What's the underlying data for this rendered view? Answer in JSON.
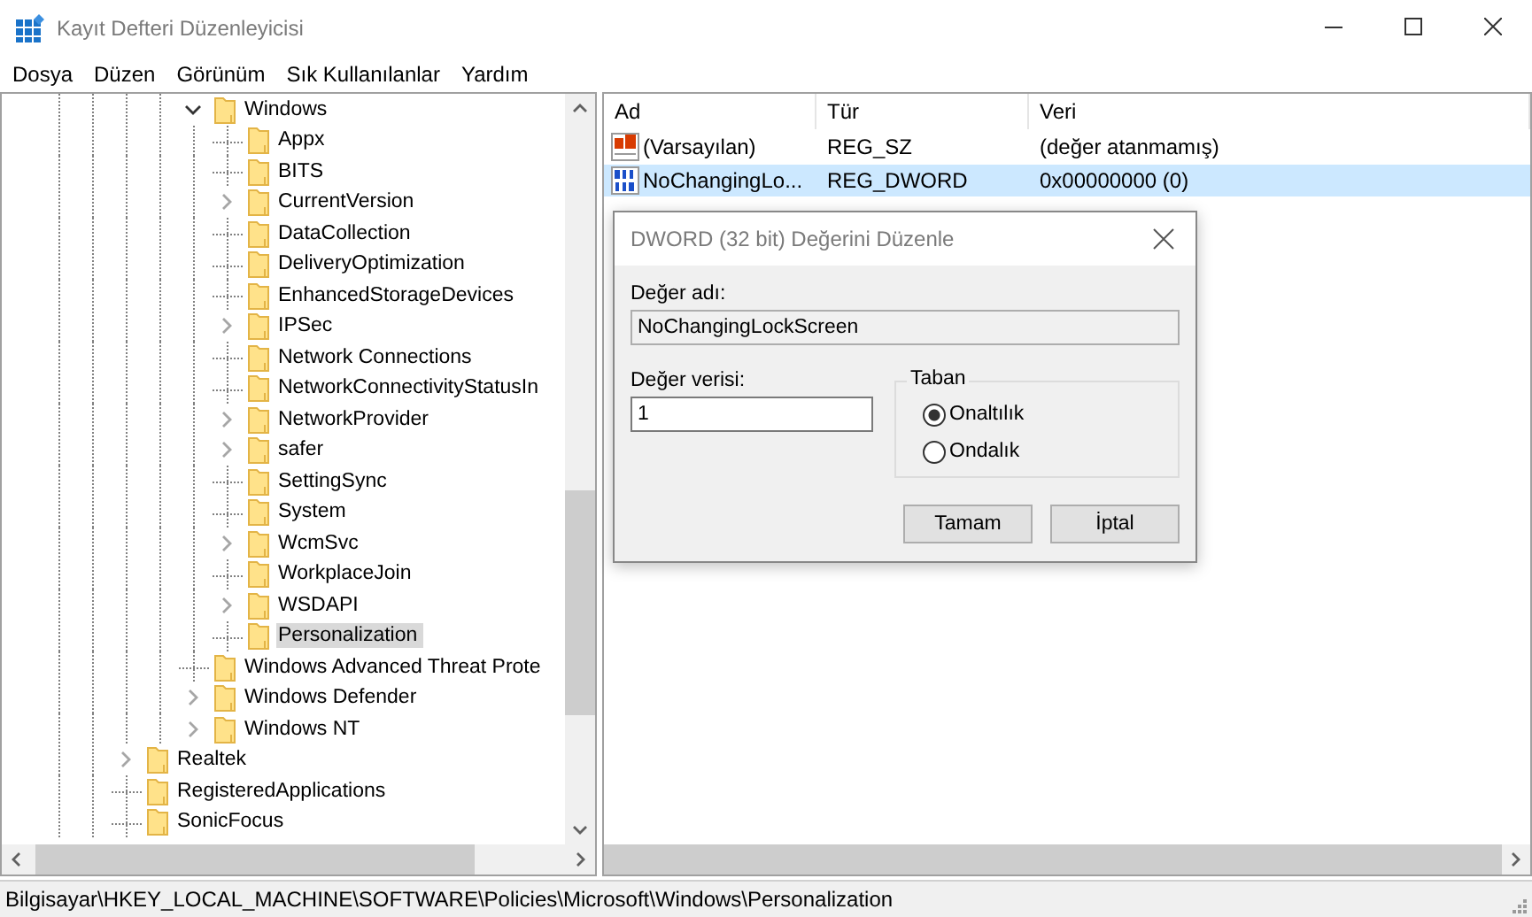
{
  "window": {
    "title": "Kayıt Defteri Düzenleyicisi"
  },
  "menu": [
    "Dosya",
    "Düzen",
    "Görünüm",
    "Sık Kullanılanlar",
    "Yardım"
  ],
  "tree": {
    "items": [
      {
        "children": [
          {
            "children": [
              {
                "label": "Windows",
                "expandable": true,
                "expanded": true,
                "selected": false,
                "children": [
                  {
                    "label": "Appx",
                    "expandable": false,
                    "expanded": false,
                    "selected": false
                  },
                  {
                    "label": "BITS",
                    "expandable": false,
                    "expanded": false,
                    "selected": false
                  },
                  {
                    "label": "CurrentVersion",
                    "expandable": true,
                    "expanded": false,
                    "selected": false
                  },
                  {
                    "label": "DataCollection",
                    "expandable": false,
                    "expanded": false,
                    "selected": false
                  },
                  {
                    "label": "DeliveryOptimization",
                    "expandable": false,
                    "expanded": false,
                    "selected": false
                  },
                  {
                    "label": "EnhancedStorageDevices",
                    "expandable": false,
                    "expanded": false,
                    "selected": false
                  },
                  {
                    "label": "IPSec",
                    "expandable": true,
                    "expanded": false,
                    "selected": false
                  },
                  {
                    "label": "Network Connections",
                    "expandable": false,
                    "expanded": false,
                    "selected": false
                  },
                  {
                    "label": "NetworkConnectivityStatusIn",
                    "expandable": false,
                    "expanded": false,
                    "selected": false
                  },
                  {
                    "label": "NetworkProvider",
                    "expandable": true,
                    "expanded": false,
                    "selected": false
                  },
                  {
                    "label": "safer",
                    "expandable": true,
                    "expanded": false,
                    "selected": false
                  },
                  {
                    "label": "SettingSync",
                    "expandable": false,
                    "expanded": false,
                    "selected": false
                  },
                  {
                    "label": "System",
                    "expandable": false,
                    "expanded": false,
                    "selected": false
                  },
                  {
                    "label": "WcmSvc",
                    "expandable": true,
                    "expanded": false,
                    "selected": false
                  },
                  {
                    "label": "WorkplaceJoin",
                    "expandable": false,
                    "expanded": false,
                    "selected": false
                  },
                  {
                    "label": "WSDAPI",
                    "expandable": true,
                    "expanded": false,
                    "selected": false
                  },
                  {
                    "label": "Personalization",
                    "expandable": false,
                    "expanded": false,
                    "selected": true
                  }
                ]
              },
              {
                "label": "Windows Advanced Threat Prote",
                "expandable": false,
                "expanded": false,
                "selected": false
              },
              {
                "label": "Windows Defender",
                "expandable": true,
                "expanded": false,
                "selected": false
              },
              {
                "label": "Windows NT",
                "expandable": true,
                "expanded": false,
                "selected": false
              }
            ]
          }
        ]
      },
      {
        "label": "Realtek",
        "expandable": true,
        "expanded": false,
        "selected": false
      },
      {
        "label": "RegisteredApplications",
        "expandable": false,
        "expanded": false,
        "selected": false
      },
      {
        "label": "SonicFocus",
        "expandable": false,
        "expanded": false,
        "selected": false
      }
    ]
  },
  "values": {
    "columns": [
      "Ad",
      "Tür",
      "Veri"
    ],
    "rows": [
      {
        "kind": "string",
        "name": "(Varsayılan)",
        "type": "REG_SZ",
        "data": "(değer atanmamış)",
        "selected": false
      },
      {
        "kind": "binary",
        "name": "NoChangingLo...",
        "type": "REG_DWORD",
        "data": "0x00000000 (0)",
        "selected": true
      }
    ]
  },
  "dialog": {
    "title": "DWORD (32 bit) Değerini Düzenle",
    "name_label": "Değer adı:",
    "name_value": "NoChangingLockScreen",
    "data_label": "Değer verisi:",
    "data_value": "1",
    "base": {
      "title": "Taban",
      "options": [
        {
          "label": "Onaltılık",
          "selected": true
        },
        {
          "label": "Ondalık",
          "selected": false
        }
      ]
    },
    "buttons": [
      "Tamam",
      "İptal"
    ]
  },
  "status_bar": "Bilgisayar\\HKEY_LOCAL_MACHINE\\SOFTWARE\\Policies\\Microsoft\\Windows\\Personalization"
}
